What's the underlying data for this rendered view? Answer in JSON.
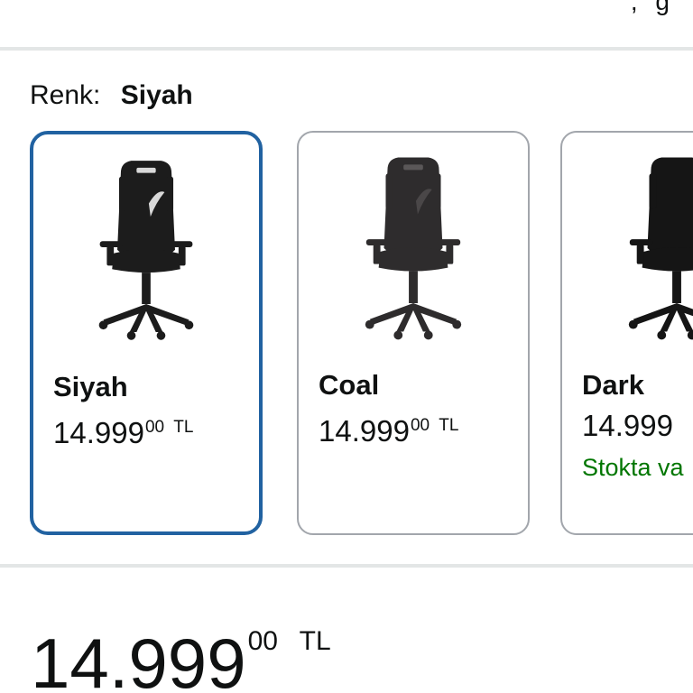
{
  "header": {
    "fragment": ", g"
  },
  "variant": {
    "label": "Renk:",
    "selected_value": "Siyah",
    "swatches": [
      {
        "name": "Siyah",
        "price_whole": "14.999",
        "price_fraction": "00",
        "currency": "TL",
        "stock": "",
        "selected": true,
        "shade": "#1c1c1c"
      },
      {
        "name": "Coal",
        "price_whole": "14.999",
        "price_fraction": "00",
        "currency": "TL",
        "stock": "",
        "selected": false,
        "shade": "#2e2c2d"
      },
      {
        "name": "Dark",
        "price_whole": "14.999",
        "price_fraction": "",
        "currency": "",
        "stock": "Stokta va",
        "selected": false,
        "shade": "#151515"
      }
    ]
  },
  "price": {
    "whole": "14.999",
    "fraction": "00",
    "currency": "TL"
  },
  "colors": {
    "selected_border": "#2162a1",
    "in_stock": "#007600",
    "divider": "#e3e6e6"
  }
}
